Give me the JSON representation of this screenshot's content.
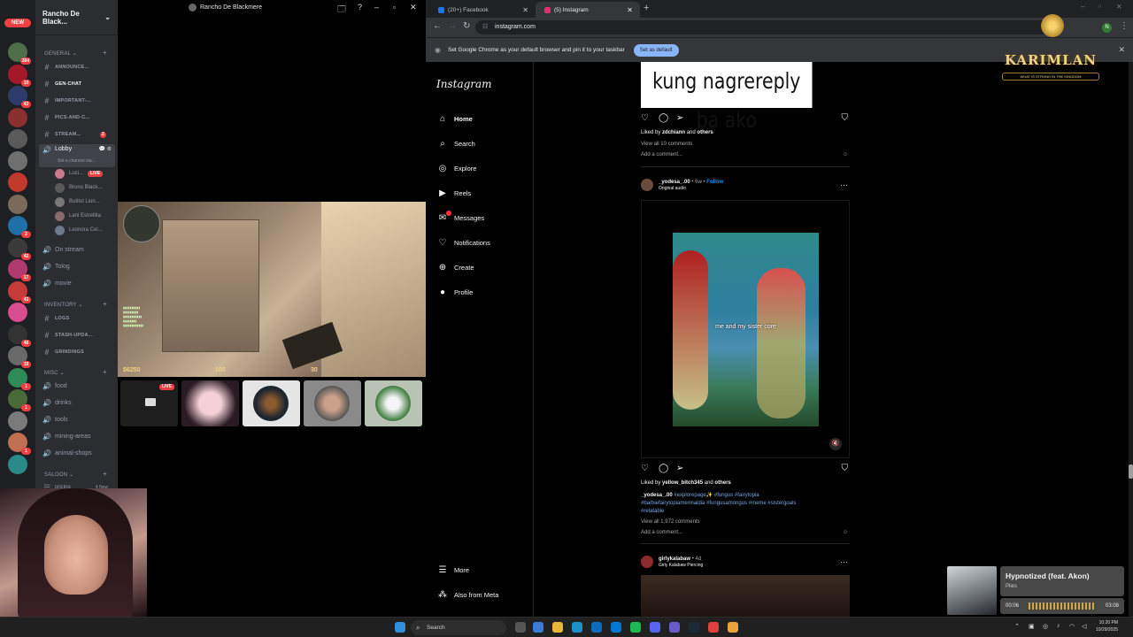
{
  "discord": {
    "new_badge": "NEW",
    "server_name": "Rancho De Black...",
    "window_title": "Rancho De Blackmere",
    "servers": [
      {
        "color": "#4e6e4a",
        "badge": "284"
      },
      {
        "color": "#a4182a",
        "badge": "10"
      },
      {
        "color": "#2f3b6a",
        "badge": "43"
      },
      {
        "color": "#8c2f2f",
        "badge": ""
      },
      {
        "color": "#5a5a5a",
        "badge": ""
      },
      {
        "color": "#6f6f6f",
        "badge": ""
      },
      {
        "color": "#c0392b",
        "badge": ""
      },
      {
        "color": "#7a6a5a",
        "badge": ""
      },
      {
        "color": "#1f6fa8",
        "badge": "2"
      },
      {
        "color": "#3a3a3a",
        "badge": "42"
      },
      {
        "color": "#b03a6e",
        "badge": "17"
      },
      {
        "color": "#c73a3a",
        "badge": "43"
      },
      {
        "color": "#d94e8f",
        "badge": ""
      },
      {
        "color": "#333",
        "badge": "46"
      },
      {
        "color": "#6a6a6a",
        "badge": "19"
      },
      {
        "color": "#2e8b57",
        "badge": "1"
      },
      {
        "color": "#4a6a3a",
        "badge": "1"
      },
      {
        "color": "#7a7a7a",
        "badge": ""
      },
      {
        "color": "#c07050",
        "badge": "1"
      },
      {
        "color": "#2a8a8a",
        "badge": ""
      }
    ],
    "categories": {
      "general": "GENERAL",
      "inventory": "INVENTORY",
      "misc": "MISC",
      "saloon": "SALOON"
    },
    "text_channels_general": [
      "ANNOUNCE...",
      "GEN-CHAT",
      "IMPORTANT-...",
      "PICS-AND-C...",
      "STREAM..."
    ],
    "stream_badge": "2",
    "lobby": {
      "name": "Lobby",
      "status_placeholder": "Set a channel sta..."
    },
    "voice_users": [
      "Luci...",
      "Bruno Black...",
      "Butitol Lion...",
      "Lani Estrellita",
      "Leonora Cel..."
    ],
    "live_label": "LIVE",
    "voice_channels": [
      "On stream",
      "Tolog",
      "movie"
    ],
    "inventory_channels": [
      "LOGS",
      "STASH-UPDA...",
      "GRINDINGS"
    ],
    "misc_channels": [
      "food",
      "drinks",
      "tools",
      "mining-areas",
      "animal-shops"
    ],
    "saloon_channels": [
      "pricing"
    ],
    "saloon_badge": "4 New",
    "hud": {
      "money": "$6250",
      "health": "100",
      "ammo": "30"
    }
  },
  "chrome": {
    "tabs": [
      {
        "label": "(20+) Facebook",
        "color": "#1877f2"
      },
      {
        "label": "(5) Instagram",
        "color": "#e1306c"
      }
    ],
    "url": "instagram.com",
    "profile_initial": "N",
    "infobar_text": "Set Google Chrome as your default browser and pin it to your taskbar",
    "set_default": "Set as default"
  },
  "instagram": {
    "logo": "Instagram",
    "nav": [
      "Home",
      "Search",
      "Explore",
      "Reels",
      "Messages",
      "Notifications",
      "Create",
      "Profile"
    ],
    "nav_icons": [
      "home-icon",
      "search-icon",
      "explore-icon",
      "reels-icon",
      "messages-icon",
      "notifications-icon",
      "create-icon",
      "profile-icon"
    ],
    "more": "More",
    "also_meta": "Also from Meta",
    "post1": {
      "meme_text": "kung nagrereply ba ako",
      "liked_by_user": "zdchiann",
      "liked_suffix": "others",
      "liked_prefix": "Liked by",
      "and": "and",
      "comments": "View all 10 comments",
      "add_comment": "Add a comment..."
    },
    "post2": {
      "user": "_yodesa_.00",
      "time": "6w",
      "follow": "Follow",
      "audio": "Original audio",
      "video_caption": "me and my sister core",
      "liked_by_user": "yellow_bitch345",
      "caption_user": "_yodesa_.00",
      "caption_tags_1": "#explorepage✨ #fungus #fairytopia",
      "caption_tags_2": "#barbiefairytopiamermaidia #fungusamongus #meme #sistergoals",
      "caption_tags_3": "#relatable",
      "comments": "View all 1,972 comments",
      "add_comment": "Add a comment..."
    },
    "post3": {
      "user": "girlykalabaw",
      "time": "4d",
      "subtitle": "Girly Kalabaw Piercing"
    }
  },
  "overlay": {
    "title": "KARIMLAN",
    "tagline": "WHAT IS STRONG IN THE KINGDOM"
  },
  "music": {
    "song": "Hypnotized (feat. Akon)",
    "artist": "Plies",
    "elapsed": "00:06",
    "duration": "03:08",
    "progress": 0.032
  },
  "taskbar": {
    "search": "Search",
    "time": "10:20 PM",
    "date": "10/29/2025"
  }
}
